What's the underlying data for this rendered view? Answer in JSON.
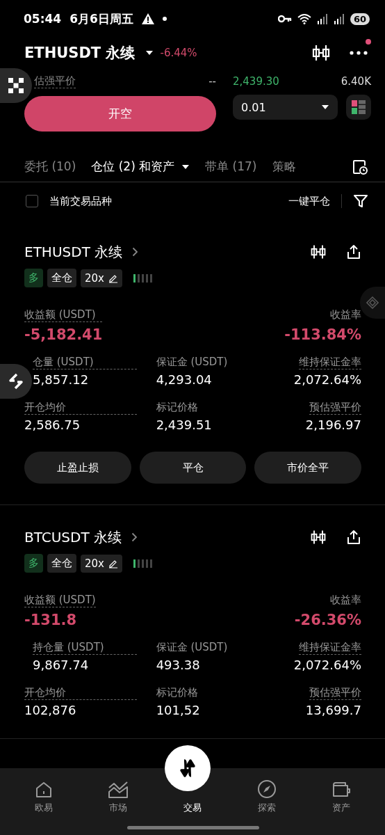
{
  "status_bar": {
    "time": "05:44",
    "date": "6月6日周五",
    "battery": "60"
  },
  "header": {
    "symbol": "ETHUSDT 永续",
    "change": "-6.44%",
    "notification": true
  },
  "order_panel": {
    "liq_label": "估强平价",
    "liq_value": "--",
    "book": [
      {
        "price": "2,439.30",
        "size": "6.40K"
      }
    ],
    "action": "开空",
    "quantity": "0.01"
  },
  "tabs": [
    {
      "label": "委托 (10)",
      "selected": false,
      "dropdown": false
    },
    {
      "label": "仓位 (2) 和资产",
      "selected": true,
      "dropdown": true
    },
    {
      "label": "带单 (17)",
      "selected": false,
      "dropdown": false
    },
    {
      "label": "策略",
      "selected": false,
      "dropdown": false
    }
  ],
  "filter": {
    "label": "当前交易品种",
    "checked": false,
    "close_all": "一键平仓"
  },
  "positions": [
    {
      "symbol": "ETHUSDT 永续",
      "side": "多",
      "margin_mode": "全仓",
      "leverage": "20x",
      "pnl_label": "收益额 (USDT)",
      "pnl": "-5,182.41",
      "rate_label": "收益率",
      "rate": "-113.84%",
      "fields": [
        {
          "label": "仓量 (USDT)",
          "value": "5,857.12",
          "dotted": true
        },
        {
          "label": "保证金 (USDT)",
          "value": "4,293.04",
          "dotted": false
        },
        {
          "label": "维持保证金率",
          "value": "2,072.64%",
          "dotted": true
        },
        {
          "label": "开仓均价",
          "value": "2,586.75",
          "dotted": true
        },
        {
          "label": "标记价格",
          "value": "2,439.51",
          "dotted": false
        },
        {
          "label": "预估强平价",
          "value": "2,196.97",
          "dotted": true
        }
      ],
      "buttons": [
        "止盈止损",
        "平仓",
        "市价全平"
      ]
    },
    {
      "symbol": "BTCUSDT 永续",
      "side": "多",
      "margin_mode": "全仓",
      "leverage": "20x",
      "pnl_label": "收益额 (USDT)",
      "pnl": "-131.8",
      "rate_label": "收益率",
      "rate": "-26.36%",
      "fields": [
        {
          "label": "持仓量 (USDT)",
          "value": "9,867.74",
          "dotted": true
        },
        {
          "label": "保证金 (USDT)",
          "value": "493.38",
          "dotted": false
        },
        {
          "label": "维持保证金率",
          "value": "2,072.64%",
          "dotted": true
        },
        {
          "label": "开仓均价",
          "value": "102,876",
          "dotted": true
        },
        {
          "label": "标记价格",
          "value": "101,52",
          "dotted": false
        },
        {
          "label": "预估强平价",
          "value": "13,699.7",
          "dotted": true
        }
      ]
    }
  ],
  "bottom_nav": [
    {
      "label": "欧易",
      "selected": false,
      "kind": "home"
    },
    {
      "label": "市场",
      "selected": false,
      "kind": "market"
    },
    {
      "label": "交易",
      "selected": true,
      "kind": "trade"
    },
    {
      "label": "探索",
      "selected": false,
      "kind": "explore"
    },
    {
      "label": "资产",
      "selected": false,
      "kind": "assets"
    }
  ]
}
